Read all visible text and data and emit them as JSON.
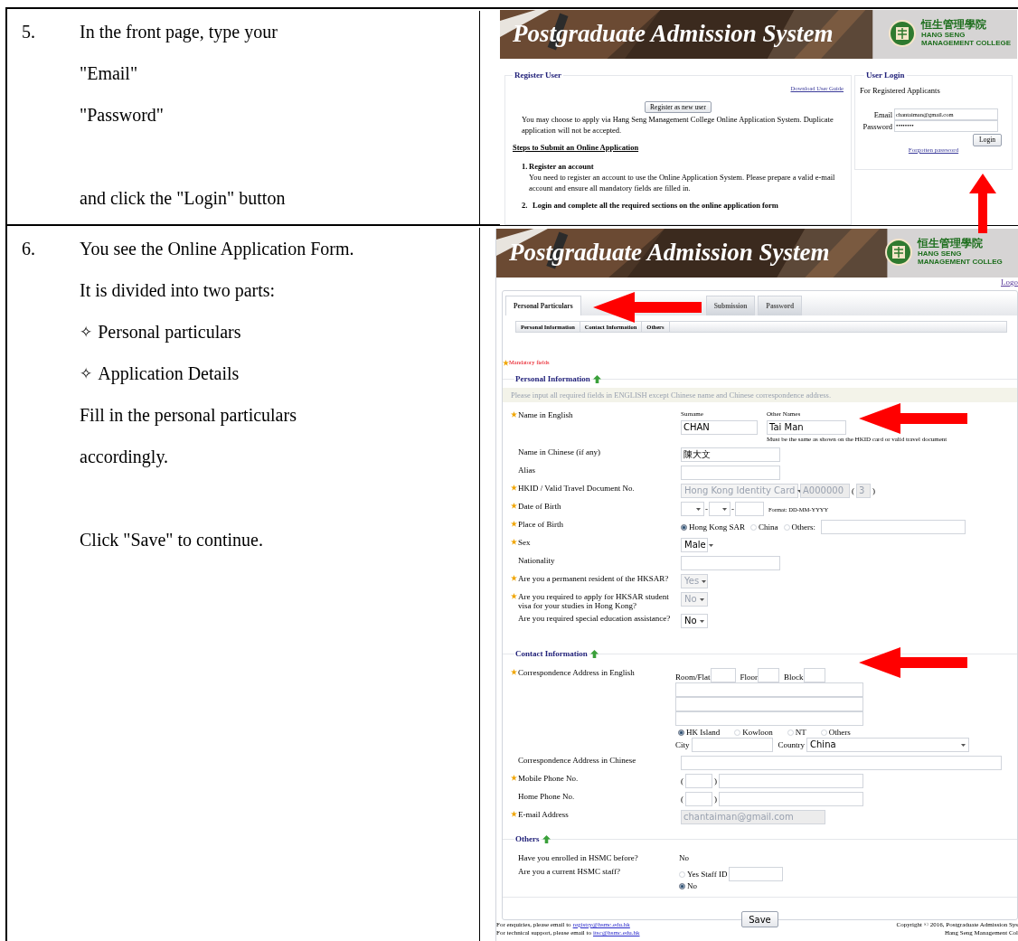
{
  "steps": [
    {
      "number": "5.",
      "lines": [
        {
          "kind": "line",
          "text": "In the front page, type your"
        },
        {
          "kind": "line",
          "text": "\"Email\""
        },
        {
          "kind": "line",
          "text": "\"Password\""
        },
        {
          "kind": "spaced",
          "text": "and click the \"Login\" button"
        }
      ],
      "screen": {
        "kind": "login",
        "banner": {
          "title": "Postgraduate Admission System",
          "college_chinese": "恒生管理學院",
          "college_english": [
            "HANG SENG",
            "MANAGEMENT COLLEGE"
          ]
        },
        "register": {
          "legend": "Register User",
          "guide_link": "Download User Guide",
          "register_button": "Register as new user",
          "note": "You may choose to apply via Hang Seng Management College Online Application System. Duplicate application will not be accepted.",
          "steps_heading": "Steps to Submit an Online Application",
          "steps": [
            {
              "number": "1.",
              "title": "Register an account",
              "body": "You need to register an account to use the Online Application System. Please prepare a valid e-mail account and ensure all mandatory fields are filled in."
            },
            {
              "number": "2.",
              "title": "Login and complete all the required sections on the online application form"
            }
          ]
        },
        "login": {
          "legend": "User Login",
          "subtitle": "For Registered Applicants",
          "email_label": "Email",
          "email_value": "chantaiman@gmail.com",
          "password_label": "Password",
          "password_value": "••••••••",
          "login_button": "Login",
          "forgot_link": "Forgotten password"
        }
      }
    },
    {
      "number": "6.",
      "lines": [
        {
          "kind": "line",
          "text": "You see the Online Application Form."
        },
        {
          "kind": "line",
          "text": "It is divided into two parts:"
        },
        {
          "kind": "bullet",
          "bullet": "✧",
          "text": "Personal particulars"
        },
        {
          "kind": "bullet",
          "bullet": "✧",
          "text": "Application Details"
        },
        {
          "kind": "line",
          "text": "Fill in the personal particulars"
        },
        {
          "kind": "line",
          "text": "accordingly."
        },
        {
          "kind": "spaced",
          "text": "Click \"Save\" to continue."
        }
      ],
      "screen": {
        "kind": "form",
        "banner": {
          "title": "Postgraduate Admission System",
          "college_chinese": "恒生管理學院",
          "college_english": [
            "HANG SENG",
            "MANAGEMENT COLLEG"
          ]
        },
        "logout_link": "Logo",
        "tabs": [
          {
            "label": "Personal Particulars",
            "selected": true
          },
          {
            "label": "Submission",
            "selected": false
          },
          {
            "label": "Password",
            "selected": false
          }
        ],
        "subtabs": [
          {
            "label": "Personal Information"
          },
          {
            "label": "Contact Information"
          },
          {
            "label": "Others"
          }
        ],
        "mandatory_note": "Mandatory fields",
        "sections": [
          {
            "title": "Personal Information",
            "hint": "Please input all required fields in ENGLISH except Chinese name and Chinese correspondence address.",
            "rows": [
              {
                "kind": "name",
                "label": "Name in English",
                "required": true,
                "surname_label": "Surname",
                "surname": "CHAN",
                "other_label": "Other Names",
                "other": "Tai Man",
                "note": "Must be the same as shown on the HKID card or valid travel document"
              },
              {
                "kind": "text",
                "label": "Name in Chinese (if any)",
                "required": false,
                "value": "陳大文"
              },
              {
                "kind": "text",
                "label": "Alias",
                "required": false
              },
              {
                "kind": "document",
                "label": "HKID / Valid Travel Document No.",
                "required": true,
                "doc_type": "Hong Kong Identity Card",
                "number": "A000000",
                "open": "(",
                "check_digit": "3",
                "close": ")"
              },
              {
                "kind": "date",
                "label": "Date of Birth",
                "required": true,
                "separators": [
                  "-",
                  "-"
                ],
                "format": "Format: DD-MM-YYYY"
              },
              {
                "kind": "radio",
                "label": "Place of Birth",
                "required": true,
                "options": [
                  {
                    "label": "Hong Kong SAR",
                    "selected": true
                  },
                  {
                    "label": "China",
                    "selected": false
                  },
                  {
                    "label": "Others:",
                    "selected": false
                  }
                ]
              },
              {
                "kind": "select",
                "label": "Sex",
                "required": true,
                "value": "Male",
                "disabled": false
              },
              {
                "kind": "text",
                "label": "Nationality",
                "required": false
              },
              {
                "kind": "select",
                "label": "Are you a permanent resident of the HKSAR?",
                "required": true,
                "value": "Yes",
                "disabled": true
              },
              {
                "kind": "select",
                "label": "Are you required to apply for HKSAR student visa for your studies in Hong Kong?",
                "required": true,
                "value": "No",
                "disabled": true
              },
              {
                "kind": "select",
                "label": "Are you required special education assistance?",
                "required": false,
                "value": "No",
                "disabled": false
              }
            ]
          },
          {
            "title": "Contact Information",
            "rows": [
              {
                "kind": "address",
                "label": "Correspondence Address in English",
                "required": true,
                "unit_labels": [
                  "Room/Flat",
                  "Floor",
                  "Block"
                ],
                "regions": [
                  {
                    "label": "HK Island",
                    "selected": true
                  },
                  {
                    "label": "Kowloon",
                    "selected": false
                  },
                  {
                    "label": "NT",
                    "selected": false
                  },
                  {
                    "label": "Others",
                    "selected": false
                  }
                ],
                "city_label": "City",
                "country_label": "Country",
                "country": "China"
              },
              {
                "kind": "wide",
                "label": "Correspondence Address in Chinese",
                "required": false
              },
              {
                "kind": "phone",
                "label": "Mobile Phone No.",
                "required": true,
                "open": "(",
                "close": ")"
              },
              {
                "kind": "phone",
                "label": "Home Phone No.",
                "required": false,
                "open": "(",
                "close": ")"
              },
              {
                "kind": "email",
                "label": "E-mail Address",
                "required": true,
                "value": "chantaiman@gmail.com"
              }
            ]
          },
          {
            "title": "Others",
            "rows": [
              {
                "kind": "static",
                "label": "Have you enrolled in HSMC before?",
                "value": "No"
              },
              {
                "kind": "staff",
                "label": "Are you a current HSMC staff?",
                "options": [
                  {
                    "label": "Yes Staff ID",
                    "selected": false
                  },
                  {
                    "label": "No",
                    "selected": true
                  }
                ]
              }
            ]
          }
        ],
        "save_button": "Save",
        "footer": {
          "contacts": [
            {
              "text": "For enquiries, please email to",
              "link": "registry@hsmc.edu.hk"
            },
            {
              "text": "For technical support, please email to",
              "link": "itsc@hsmc.edu.hk"
            }
          ],
          "copyright": [
            "Copyright © 2016, Postgraduate Admission Sys",
            "Hang Seng Management Col"
          ]
        }
      }
    }
  ]
}
